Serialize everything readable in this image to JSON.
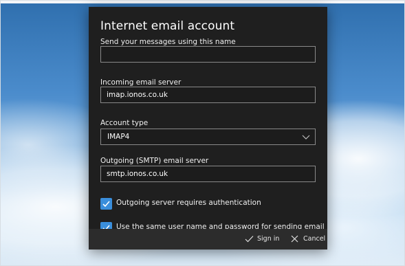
{
  "dialog": {
    "title": "Internet email account",
    "name_field": {
      "label": "Send your messages using this name",
      "value": ""
    },
    "incoming": {
      "label": "Incoming email server",
      "value": "imap.ionos.co.uk"
    },
    "account_type": {
      "label": "Account type",
      "value": "IMAP4"
    },
    "outgoing": {
      "label": "Outgoing (SMTP) email server",
      "value": "smtp.ionos.co.uk"
    },
    "options": [
      {
        "label": "Outgoing server requires authentication",
        "checked": true
      },
      {
        "label": "Use the same user name and password for sending email",
        "checked": true
      }
    ],
    "footer": {
      "sign_in_label": "Sign in",
      "cancel_label": "Cancel"
    }
  },
  "colors": {
    "accent": "#3a8edb",
    "dialog_bg": "#1f1f1f",
    "footer_bg": "#2c2c2c"
  },
  "icons": {
    "sign_in": "checkmark-icon",
    "cancel": "close-icon",
    "select": "chevron-down-icon"
  }
}
